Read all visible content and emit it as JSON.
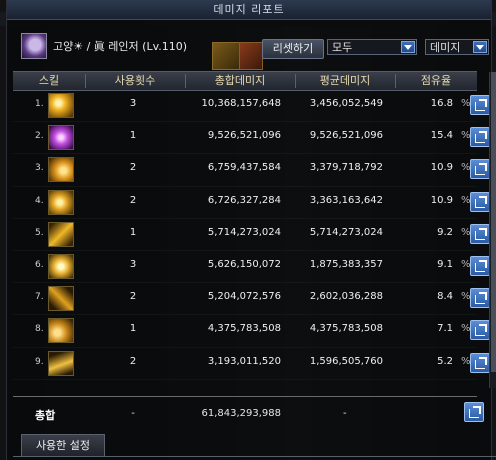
{
  "window": {
    "title": "데미지 리포트"
  },
  "header": {
    "character_name": "고양☀ / 眞 레인저 (Lv.110)",
    "reset_label": "리셋하기",
    "filter_scope": "모두",
    "filter_type": "데미지"
  },
  "table": {
    "columns": [
      "스킬",
      "사용횟수",
      "총합데미지",
      "평균데미지",
      "점유율"
    ],
    "rows": [
      {
        "rank": "1.",
        "icon": "skill-gold-burst-icon",
        "count": "3",
        "total": "10,368,157,648",
        "avg": "3,456,052,549",
        "pct": "16.8",
        "pct_mark": "%"
      },
      {
        "rank": "2.",
        "icon": "skill-purple-cross-icon",
        "count": "1",
        "total": "9,526,521,096",
        "avg": "9,526,521,096",
        "pct": "15.4",
        "pct_mark": "%"
      },
      {
        "rank": "3.",
        "icon": "skill-gold-swirl-icon",
        "count": "2",
        "total": "6,759,437,584",
        "avg": "3,379,718,792",
        "pct": "10.9",
        "pct_mark": "%"
      },
      {
        "rank": "4.",
        "icon": "skill-gold-spin-icon",
        "count": "2",
        "total": "6,726,327,284",
        "avg": "3,363,163,642",
        "pct": "10.9",
        "pct_mark": "%"
      },
      {
        "rank": "5.",
        "icon": "skill-gold-shot-icon",
        "count": "1",
        "total": "5,714,273,024",
        "avg": "5,714,273,024",
        "pct": "9.2",
        "pct_mark": "%"
      },
      {
        "rank": "6.",
        "icon": "skill-gold-star-icon",
        "count": "3",
        "total": "5,626,150,072",
        "avg": "1,875,383,357",
        "pct": "9.1",
        "pct_mark": "%"
      },
      {
        "rank": "7.",
        "icon": "skill-gold-slash-icon",
        "count": "2",
        "total": "5,204,072,576",
        "avg": "2,602,036,288",
        "pct": "8.4",
        "pct_mark": "%"
      },
      {
        "rank": "8.",
        "icon": "skill-gold-wave-icon",
        "count": "1",
        "total": "4,375,783,508",
        "avg": "4,375,783,508",
        "pct": "7.1",
        "pct_mark": "%"
      },
      {
        "rank": "9.",
        "icon": "skill-gold-dash-icon",
        "count": "2",
        "total": "3,193,011,520",
        "avg": "1,596,505,760",
        "pct": "5.2",
        "pct_mark": "%"
      }
    ]
  },
  "totals": {
    "label": "총합",
    "count": "-",
    "total": "61,843,293,988",
    "avg": "-"
  },
  "bottom_tab": {
    "label": "사용한 설정"
  },
  "colors": {
    "accent": "#3a6fc0",
    "header_text": "#e8dcb0",
    "icon_gold": "#e0a020",
    "icon_purple": "#c050e0"
  }
}
